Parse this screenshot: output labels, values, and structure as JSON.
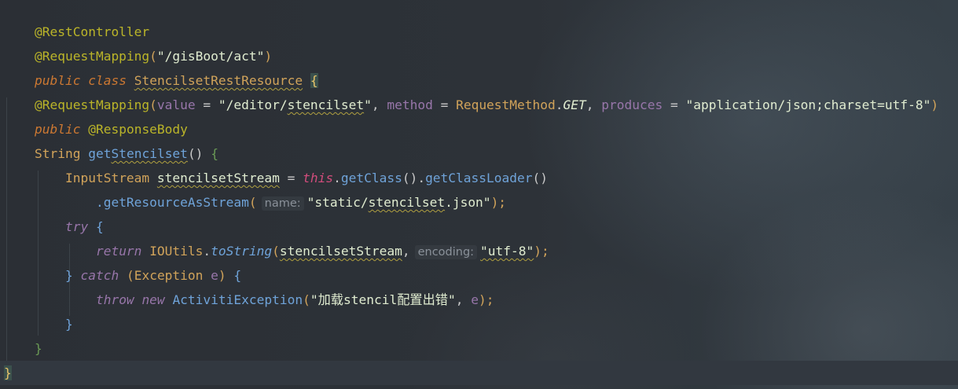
{
  "code": {
    "l1": {
      "ann": "@RestController"
    },
    "l2": {
      "ann": "@RequestMapping",
      "open": "(",
      "path": "\"/gisBoot/act\"",
      "close": ")"
    },
    "l3": {
      "kw1": "public",
      "kw2": "class",
      "name": "StencilsetRestResource",
      "brace": "{"
    },
    "l5": {
      "ann": "@RequestMapping",
      "open": "(",
      "p1": "value",
      "eq1": " = ",
      "s1a": "\"/editor/",
      "s1b": "stencilset",
      "s1c": "\"",
      "c1": ", ",
      "p2": "method",
      "eq2": " = ",
      "cls": "RequestMethod",
      "dot": ".",
      "get": "GET",
      "c2": ", ",
      "p3": "produces",
      "eq3": " = ",
      "s3": "\"application/json;charset=utf-8\"",
      "close": ")"
    },
    "l6": {
      "kw": "public",
      "ann": "@ResponseBody"
    },
    "l7": {
      "type": "String",
      "fn1": "get",
      "fn2": "Stencilset",
      "parens": "()",
      "brace": "{"
    },
    "l8": {
      "type": "InputStream",
      "var": "stencilsetStream",
      "eq": " = ",
      "this": "this",
      "dot": ".",
      "m1": "getClass",
      "p1": "()",
      "dot2": ".",
      "m2": "getClassLoader",
      "p2": "()"
    },
    "l9": {
      "m": ".getResourceAsStream",
      "open": "(",
      "hint": "name:",
      "s1": "\"static/",
      "s2": "stencilset",
      "s3": ".json\"",
      "close": ");"
    },
    "l10": {
      "kw": "try",
      "brace": "{"
    },
    "l11": {
      "kw": "return",
      "cls": "IOUtils",
      "dot": ".",
      "m": "toString",
      "open": "(",
      "var": "stencilsetStream",
      "comma": ",",
      "hint": "encoding:",
      "s": "\"utf-8\"",
      "close": ");"
    },
    "l12": {
      "br": "}",
      "kw": "catch",
      "open": "(",
      "type": "Exception",
      "param": "e",
      "close": ")",
      "brace": "{"
    },
    "l13": {
      "kw1": "throw",
      "kw2": "new",
      "cls": "ActivitiException",
      "open": "(",
      "s": "\"加载stencil配置出错\"",
      "comma": ", ",
      "param": "e",
      "close": ");"
    },
    "l14": {
      "br": "}"
    },
    "l15": {
      "br": "}"
    },
    "l16": {
      "br": "}"
    }
  }
}
